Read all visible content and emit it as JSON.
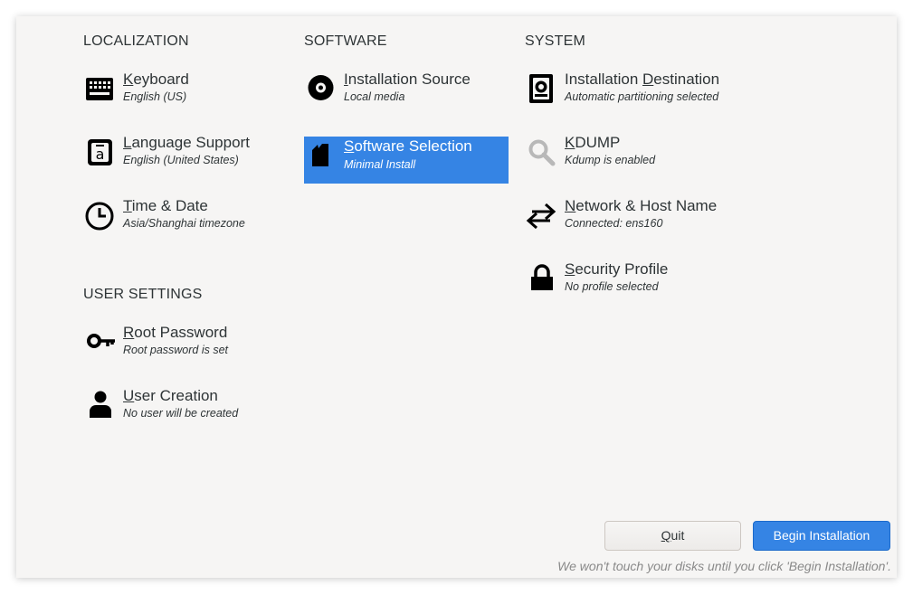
{
  "sections": {
    "localization": "LOCALIZATION",
    "software": "SOFTWARE",
    "system": "SYSTEM",
    "user_settings": "USER SETTINGS"
  },
  "spokes": {
    "keyboard": {
      "key": "K",
      "rest": "eyboard",
      "status": "English (US)",
      "icon": "keyboard-icon"
    },
    "language": {
      "key": "L",
      "rest": "anguage Support",
      "status": "English (United States)",
      "icon": "language-icon"
    },
    "time": {
      "key": "T",
      "rest": "ime & Date",
      "status": "Asia/Shanghai timezone",
      "icon": "clock-icon"
    },
    "source": {
      "key": "I",
      "rest": "nstallation Source",
      "status": "Local media",
      "icon": "disc-icon"
    },
    "software": {
      "key": "S",
      "rest": "oftware Selection",
      "status": "Minimal Install",
      "icon": "package-icon"
    },
    "destination": {
      "pre": "Installation ",
      "key": "D",
      "rest": "estination",
      "status": "Automatic partitioning selected",
      "icon": "harddisk-icon"
    },
    "kdump": {
      "key": "K",
      "rest": "DUMP",
      "status": "Kdump is enabled",
      "icon": "magnifier-icon"
    },
    "network": {
      "key": "N",
      "rest": "etwork & Host Name",
      "status": "Connected: ens160",
      "icon": "network-arrows-icon"
    },
    "security": {
      "key": "S",
      "rest": "ecurity Profile",
      "status": "No profile selected",
      "icon": "lock-icon"
    },
    "root": {
      "key": "R",
      "rest": "oot Password",
      "status": "Root password is set",
      "icon": "key-icon"
    },
    "user": {
      "key": "U",
      "rest": "ser Creation",
      "status": "No user will be created",
      "icon": "user-icon"
    }
  },
  "buttons": {
    "quit_key": "Q",
    "quit_rest": "uit",
    "begin": "Begin Installation"
  },
  "footer_note": "We won't touch your disks until you click 'Begin Installation'.",
  "colors": {
    "accent": "#3584e4",
    "background": "#f6f5f4",
    "text": "#2e3436"
  }
}
